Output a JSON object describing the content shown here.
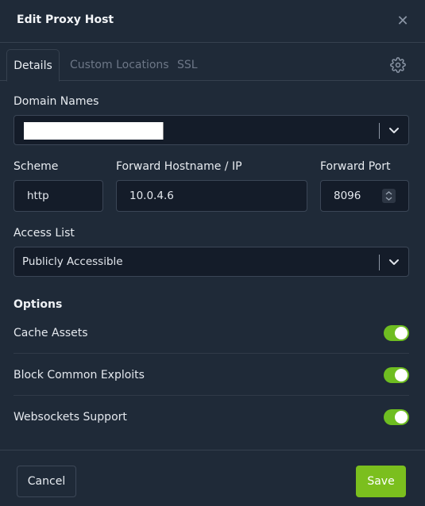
{
  "dialog": {
    "title": "Edit Proxy Host",
    "close_icon": "close-icon"
  },
  "tabs": [
    {
      "label": "Details",
      "active": true
    },
    {
      "label": "Custom Locations",
      "active": false
    },
    {
      "label": "SSL",
      "active": false
    }
  ],
  "settings_icon": "gear-icon",
  "domain_names": {
    "label": "Domain Names",
    "value": ""
  },
  "scheme": {
    "label": "Scheme",
    "value": "http"
  },
  "forward_host": {
    "label": "Forward Hostname / IP",
    "value": "10.0.4.6"
  },
  "forward_port": {
    "label": "Forward Port",
    "value": "8096"
  },
  "access_list": {
    "label": "Access List",
    "value": "Publicly Accessible"
  },
  "options": {
    "title": "Options",
    "items": [
      {
        "label": "Cache Assets",
        "enabled": true
      },
      {
        "label": "Block Common Exploits",
        "enabled": true
      },
      {
        "label": "Websockets Support",
        "enabled": true
      }
    ]
  },
  "footer": {
    "cancel_label": "Cancel",
    "save_label": "Save"
  },
  "colors": {
    "background": "#1f2a38",
    "input_bg": "#141c29",
    "accent_green": "#7bbf1e",
    "toggle_on": "#6ebd21"
  }
}
